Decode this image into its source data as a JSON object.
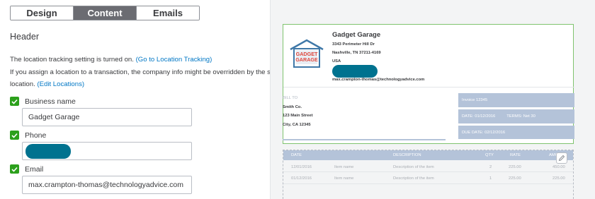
{
  "tabs": [
    {
      "label": "Design",
      "active": false
    },
    {
      "label": "Content",
      "active": true
    },
    {
      "label": "Emails",
      "active": false
    }
  ],
  "header": {
    "title": "Header",
    "location_notice": {
      "text": "The location tracking setting is turned on.",
      "link": "(Go to Location Tracking)"
    },
    "override_notice": {
      "line1": "If you assign a location to a transaction, the company info might be overridden by the selected",
      "line2": "location.",
      "link": "(Edit Locations)"
    },
    "business_name": {
      "label": "Business name",
      "checked": true,
      "value": "Gadget Garage"
    },
    "phone": {
      "label": "Phone",
      "checked": true,
      "value": "[redacted]"
    },
    "email": {
      "label": "Email",
      "checked": true,
      "value": "max.crampton-thomas@technologyadvice.com"
    }
  },
  "preview": {
    "company": {
      "name": "Gadget Garage",
      "address1": "3343 Perimeter Hill Dr",
      "address2": "Nashville, TN 37211-4169",
      "country": "USA",
      "email": "max.crampton-thomas@technologyadvice.com"
    },
    "logo": {
      "line1": "GADGET",
      "line2": "GARAGE",
      "icon": "garage-logo-icon"
    },
    "bill_to": {
      "label": "BILL TO",
      "name": "Smith Co.",
      "street": "123 Main Street",
      "city": "City, CA 12345"
    },
    "invoice_info": {
      "invoice": "Invoice  12345",
      "date": "DATE:  01/12/2016",
      "terms": "TERMS:  Net 30",
      "due_date": "DUE DATE: 02/12/2016"
    },
    "table": {
      "headers": [
        "DATE",
        "DESCRIPTION",
        "QTY",
        "RATE",
        "AMOUNT"
      ],
      "rows": [
        {
          "date": "12/01/2016",
          "item": "Item name",
          "description": "Description of the item",
          "qty": "2",
          "rate": "225.00",
          "amount": "450.00"
        },
        {
          "date": "01/12/2016",
          "item": "Item name",
          "description": "Description of the item",
          "qty": "1",
          "rate": "225.00",
          "amount": "225.00"
        }
      ]
    }
  },
  "colors": {
    "accent_green": "#2ca01c",
    "link_blue": "#0077c5",
    "preview_header_blue": "#b4c3d9",
    "redaction": "#00728f"
  }
}
